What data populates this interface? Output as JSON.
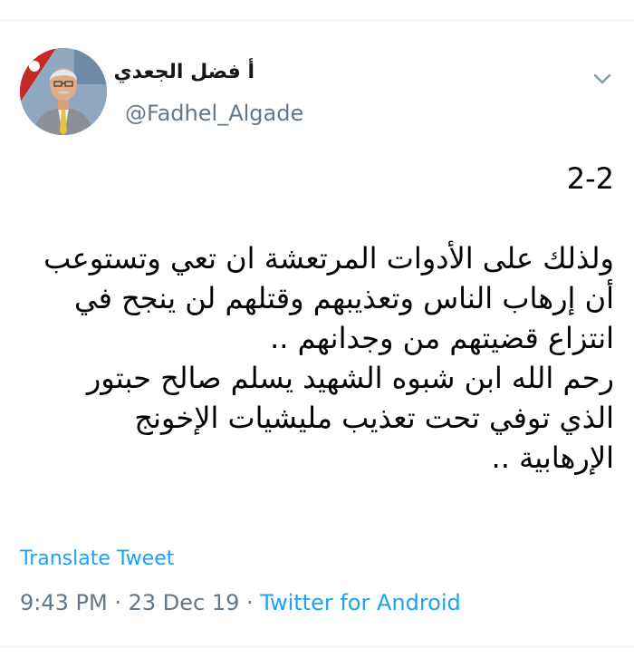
{
  "author": {
    "display_name": "أ فضل الجعدي",
    "handle": "@Fadhel_Algade",
    "avatar_icon": "profile-photo"
  },
  "tweet": {
    "lines": [
      "2-2",
      "",
      "ولذلك على الأدوات المرتعشة ان تعي وتستوعب",
      "أن إرهاب الناس وتعذيبهم وقتلهم لن ينجح في",
      "انتزاع قضيتهم من وجدانهم ..",
      "رحم الله ابن شبوه الشهيد يسلم صالح حبتور",
      "الذي توفي تحت تعذيب مليشيات الإخونج",
      "الإرهابية .."
    ]
  },
  "actions": {
    "translate_label": "Translate Tweet",
    "menu_icon": "chevron-down-icon"
  },
  "meta": {
    "time": "9:43 PM",
    "separator": " · ",
    "date": "23 Dec 19",
    "source": "Twitter for Android"
  },
  "colors": {
    "link": "#1da1f2",
    "secondary_text": "#657786",
    "divider": "#e6ecf0"
  }
}
